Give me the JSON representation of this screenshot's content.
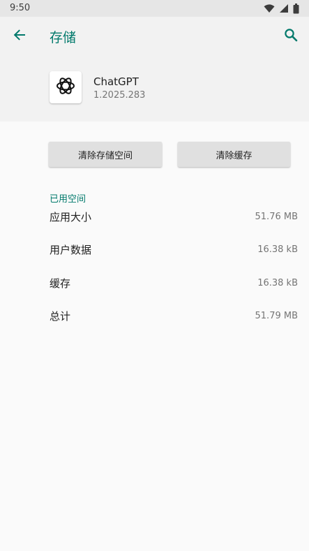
{
  "status_bar": {
    "time": "9:50"
  },
  "header": {
    "title": "存储"
  },
  "app": {
    "name": "ChatGPT",
    "version": "1.2025.283"
  },
  "actions": {
    "clear_storage": "清除存储空间",
    "clear_cache": "清除缓存"
  },
  "used_space": {
    "title": "已用空间",
    "rows": [
      {
        "label": "应用大小",
        "value": "51.76 MB"
      },
      {
        "label": "用户数据",
        "value": "16.38 kB"
      },
      {
        "label": "缓存",
        "value": "16.38 kB"
      },
      {
        "label": "总计",
        "value": "51.79 MB"
      }
    ]
  },
  "colors": {
    "accent": "#00796b",
    "status_bar": "#e6e6e6",
    "header": "#f2f2f2",
    "background": "#fafafa"
  },
  "icons": [
    "wifi-icon",
    "signal-icon",
    "battery-icon",
    "back-arrow-icon",
    "search-icon",
    "chatgpt-logo-icon"
  ]
}
